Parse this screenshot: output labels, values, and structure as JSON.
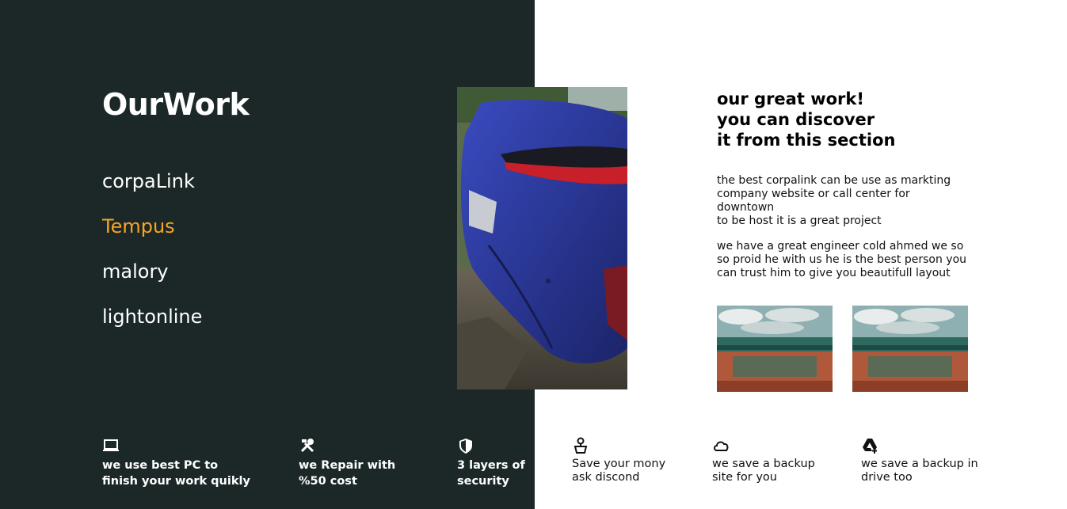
{
  "section": {
    "title": "OurWork",
    "nav_items": [
      "corpaLink",
      "Tempus",
      "malory",
      "lightonline"
    ],
    "active_item": "Tempus"
  },
  "intro": {
    "heading": "our great work!\nyou can discover\nit from this section",
    "paragraph_1": "the best corpalink can be use as markting\ncompany website or call center for downtown\nto be host it is a great project",
    "paragraph_2": "we have a great engineer cold ahmed we so\nso proid he with us he is the best person you\ncan trust him to give you beautifull layout"
  },
  "features": [
    {
      "icon": "laptop-icon",
      "text": "we use best PC to\nfinish your work quikly"
    },
    {
      "icon": "tools-icon",
      "text": "we Repair with\n%50 cost"
    },
    {
      "icon": "shield-icon",
      "text": "3 layers of\nsecurity"
    },
    {
      "icon": "person-icon",
      "text": "Save your mony\nask discond"
    },
    {
      "icon": "cloud-icon",
      "text": "we save a backup\nsite for you"
    },
    {
      "icon": "drive-icon",
      "text": "we save a backup in\ndrive too"
    }
  ],
  "colors": {
    "dark_panel": "#1c2828",
    "active_nav": "#f5a623",
    "car_blue": "#2b3aa0"
  }
}
